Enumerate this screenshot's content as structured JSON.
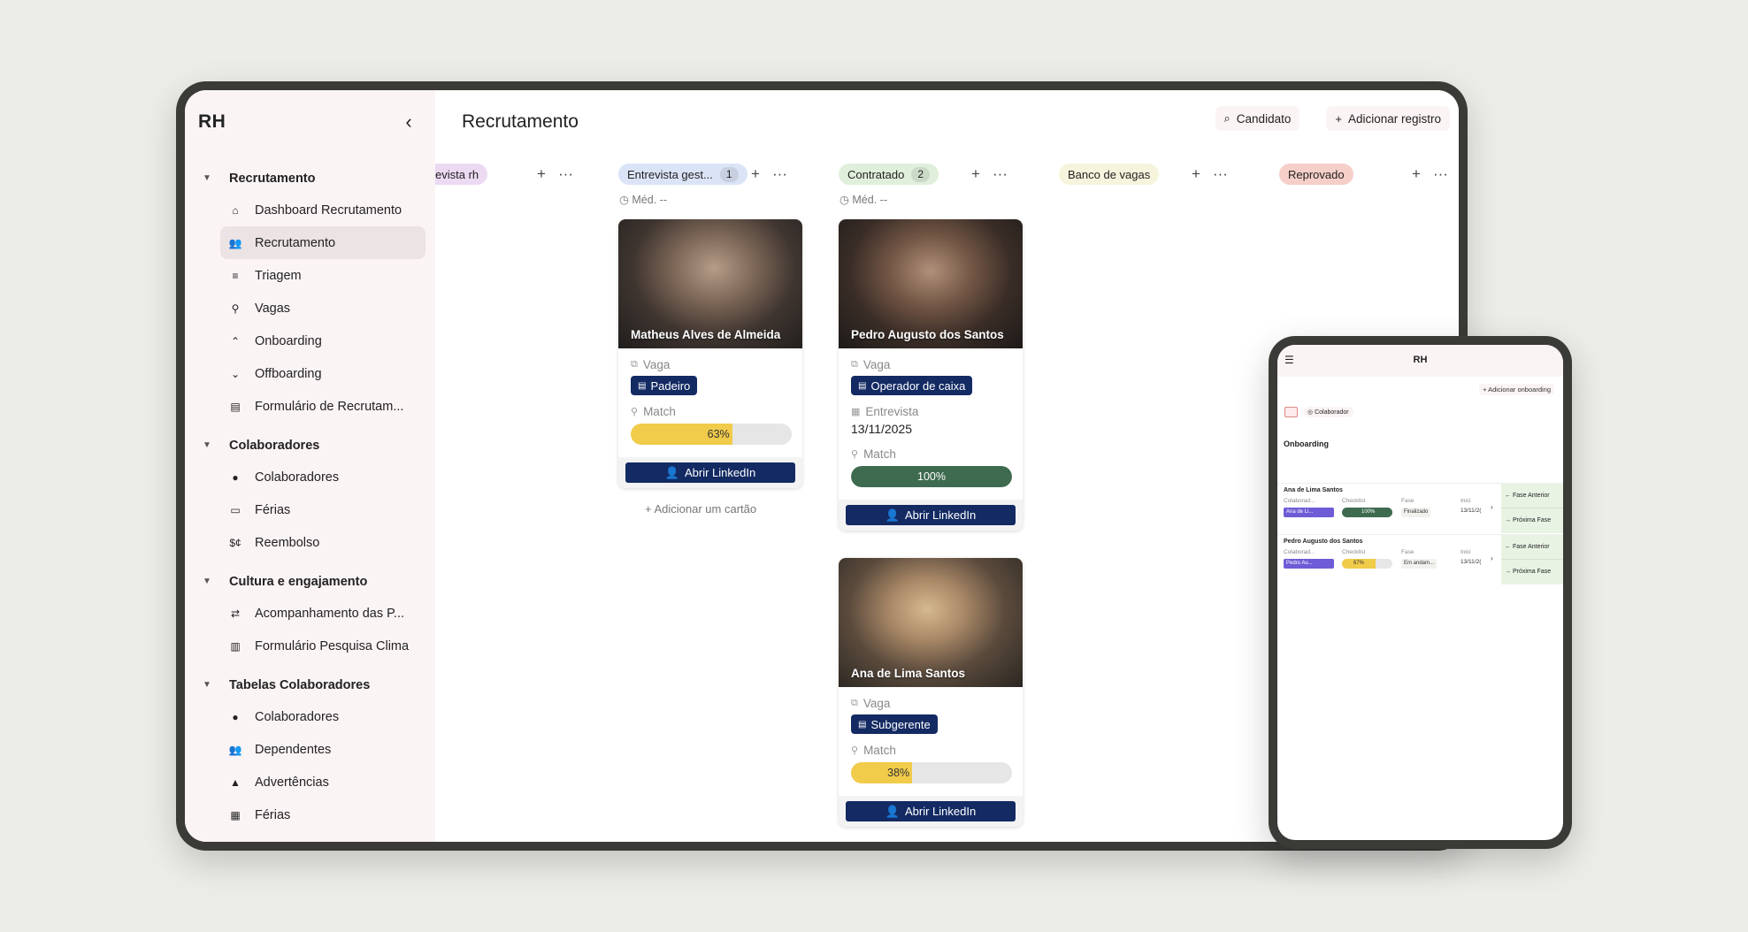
{
  "sidebar": {
    "title": "RH",
    "collapse_icon": "chevron-left-icon",
    "sections": [
      {
        "title": "Recrutamento",
        "items": [
          {
            "label": "Dashboard Recrutamento",
            "icon": "⌂",
            "active": false
          },
          {
            "label": "Recrutamento",
            "icon": "👥",
            "active": true
          },
          {
            "label": "Triagem",
            "icon": "≡",
            "active": false
          },
          {
            "label": "Vagas",
            "icon": "⚲",
            "active": false
          },
          {
            "label": "Onboarding",
            "icon": "⌃",
            "active": false
          },
          {
            "label": "Offboarding",
            "icon": "⌄",
            "active": false
          },
          {
            "label": "Formulário de Recrutam...",
            "icon": "▤",
            "active": false
          }
        ]
      },
      {
        "title": "Colaboradores",
        "items": [
          {
            "label": "Colaboradores",
            "icon": "●",
            "active": false
          },
          {
            "label": "Férias",
            "icon": "▭",
            "active": false
          },
          {
            "label": "Reembolso",
            "icon": "$¢",
            "active": false
          }
        ]
      },
      {
        "title": "Cultura e engajamento",
        "items": [
          {
            "label": "Acompanhamento das P...",
            "icon": "⇄",
            "active": false
          },
          {
            "label": "Formulário Pesquisa Clima",
            "icon": "▥",
            "active": false
          }
        ]
      },
      {
        "title": "Tabelas Colaboradores",
        "items": [
          {
            "label": "Colaboradores",
            "icon": "●",
            "active": false
          },
          {
            "label": "Dependentes",
            "icon": "👥",
            "active": false
          },
          {
            "label": "Advertências",
            "icon": "▲",
            "active": false
          },
          {
            "label": "Férias",
            "icon": "▦",
            "active": false
          }
        ]
      }
    ]
  },
  "header": {
    "title": "Recrutamento",
    "search_button": "Candidato",
    "add_button": "Adicionar registro"
  },
  "board": {
    "columns": [
      {
        "label": "evista rh",
        "count": "",
        "color": "#ecd9f2"
      },
      {
        "label": "Entrevista gest...",
        "count": "1",
        "color": "#dbe4f7",
        "med": "Méd. --"
      },
      {
        "label": "Contratado",
        "count": "2",
        "color": "#e0efdb",
        "med": "Méd. --"
      },
      {
        "label": "Banco de vagas",
        "count": "",
        "color": "#f7f4dd"
      },
      {
        "label": "Reprovado",
        "count": "",
        "color": "#f6cfc9"
      }
    ],
    "add_card_label": "+ Adicionar um cartão",
    "cards": [
      {
        "name": "Matheus Alves de Almeida",
        "vaga_label": "Vaga",
        "vaga": "Padeiro",
        "match_label": "Match",
        "match": 63,
        "match_text": "63%",
        "match_color": "#f1cb4a",
        "linkedin": "Abrir LinkedIn"
      },
      {
        "name": "Pedro Augusto dos Santos",
        "vaga_label": "Vaga",
        "vaga": "Operador de caixa",
        "entrevista_label": "Entrevista",
        "entrevista": "13/11/2025",
        "match_label": "Match",
        "match": 100,
        "match_text": "100%",
        "match_color": "#3e6b4f",
        "linkedin": "Abrir LinkedIn"
      },
      {
        "name": "Ana de Lima Santos",
        "vaga_label": "Vaga",
        "vaga": "Subgerente",
        "match_label": "Match",
        "match": 38,
        "match_text": "38%",
        "match_color": "#f1cb4a",
        "linkedin": "Abrir LinkedIn"
      }
    ]
  },
  "mobile": {
    "title": "RH",
    "add_button": "+ Adicionar onboarding",
    "filter": "Colaborador",
    "section": "Onboarding",
    "rows": [
      {
        "name": "Ana de Lima Santos",
        "colab_label": "Colaborad...",
        "colab": "Ana de Li...",
        "checklist_label": "Checklist",
        "checklist": 100,
        "checklist_text": "100%",
        "checklist_color": "#3e6b4f",
        "fase_label": "Fase",
        "fase": "Finalizado",
        "inicio_label": "Inici",
        "inicio": "13/11/2(",
        "prev": "← Fase Anterior",
        "next": "→ Próxima Fase"
      },
      {
        "name": "Pedro Augusto dos Santos",
        "colab_label": "Colaborad...",
        "colab": "Pedro Au...",
        "checklist_label": "Checklist",
        "checklist": 67,
        "checklist_text": "67%",
        "checklist_color": "#f1cb4a",
        "fase_label": "Fase",
        "fase": "Em andam...",
        "inicio_label": "Inici",
        "inicio": "13/11/2(",
        "prev": "← Fase Anterior",
        "next": "→ Próxima Fase"
      }
    ]
  }
}
